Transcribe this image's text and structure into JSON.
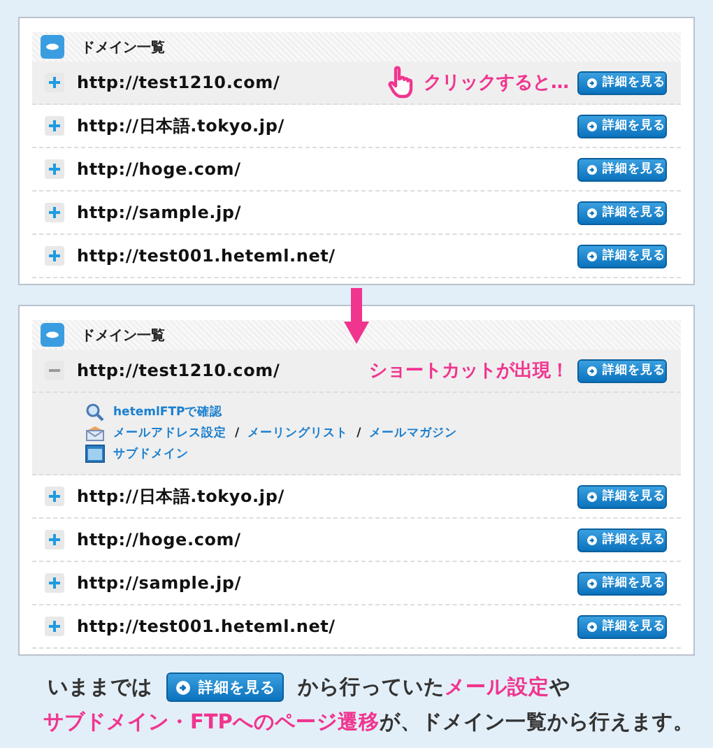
{
  "panels": [
    {
      "title": "ドメイン一覧",
      "rows": [
        {
          "url": "http://test1210.com/",
          "hovered": true,
          "expanded": false,
          "button": "詳細を見る",
          "callout": "クリックすると…",
          "cursor": true
        },
        {
          "url": "http://日本語.tokyo.jp/",
          "hovered": false,
          "expanded": false,
          "button": "詳細を見る"
        },
        {
          "url": "http://hoge.com/",
          "hovered": false,
          "expanded": false,
          "button": "詳細を見る"
        },
        {
          "url": "http://sample.jp/",
          "hovered": false,
          "expanded": false,
          "button": "詳細を見る"
        },
        {
          "url": "http://test001.heteml.net/",
          "hovered": false,
          "expanded": false,
          "button": "詳細を見る"
        }
      ]
    },
    {
      "title": "ドメイン一覧",
      "rows": [
        {
          "url": "http://test1210.com/",
          "hovered": true,
          "expanded": true,
          "button": "詳細を見る",
          "callout": "ショートカットが出現！",
          "cursor": false,
          "shortcuts": [
            {
              "kind": "search",
              "links": [
                "hetemlFTPで確認"
              ]
            },
            {
              "kind": "mail",
              "separator": "/",
              "links": [
                "メールアドレス設定",
                "メーリングリスト",
                "メールマガジン"
              ]
            },
            {
              "kind": "domain",
              "links": [
                "サブドメイン"
              ]
            }
          ]
        },
        {
          "url": "http://日本語.tokyo.jp/",
          "hovered": false,
          "expanded": false,
          "button": "詳細を見る"
        },
        {
          "url": "http://hoge.com/",
          "hovered": false,
          "expanded": false,
          "button": "詳細を見る"
        },
        {
          "url": "http://sample.jp/",
          "hovered": false,
          "expanded": false,
          "button": "詳細を見る"
        },
        {
          "url": "http://test001.heteml.net/",
          "hovered": false,
          "expanded": false,
          "button": "詳細を見る"
        }
      ]
    }
  ],
  "caption": {
    "before": "いままでは",
    "button": "詳細を見る",
    "after": "から行っていた**メール設定**や",
    "line2": "**サブドメイン・FTPへのページ遷移**が、ドメイン一覧から行えます。"
  }
}
